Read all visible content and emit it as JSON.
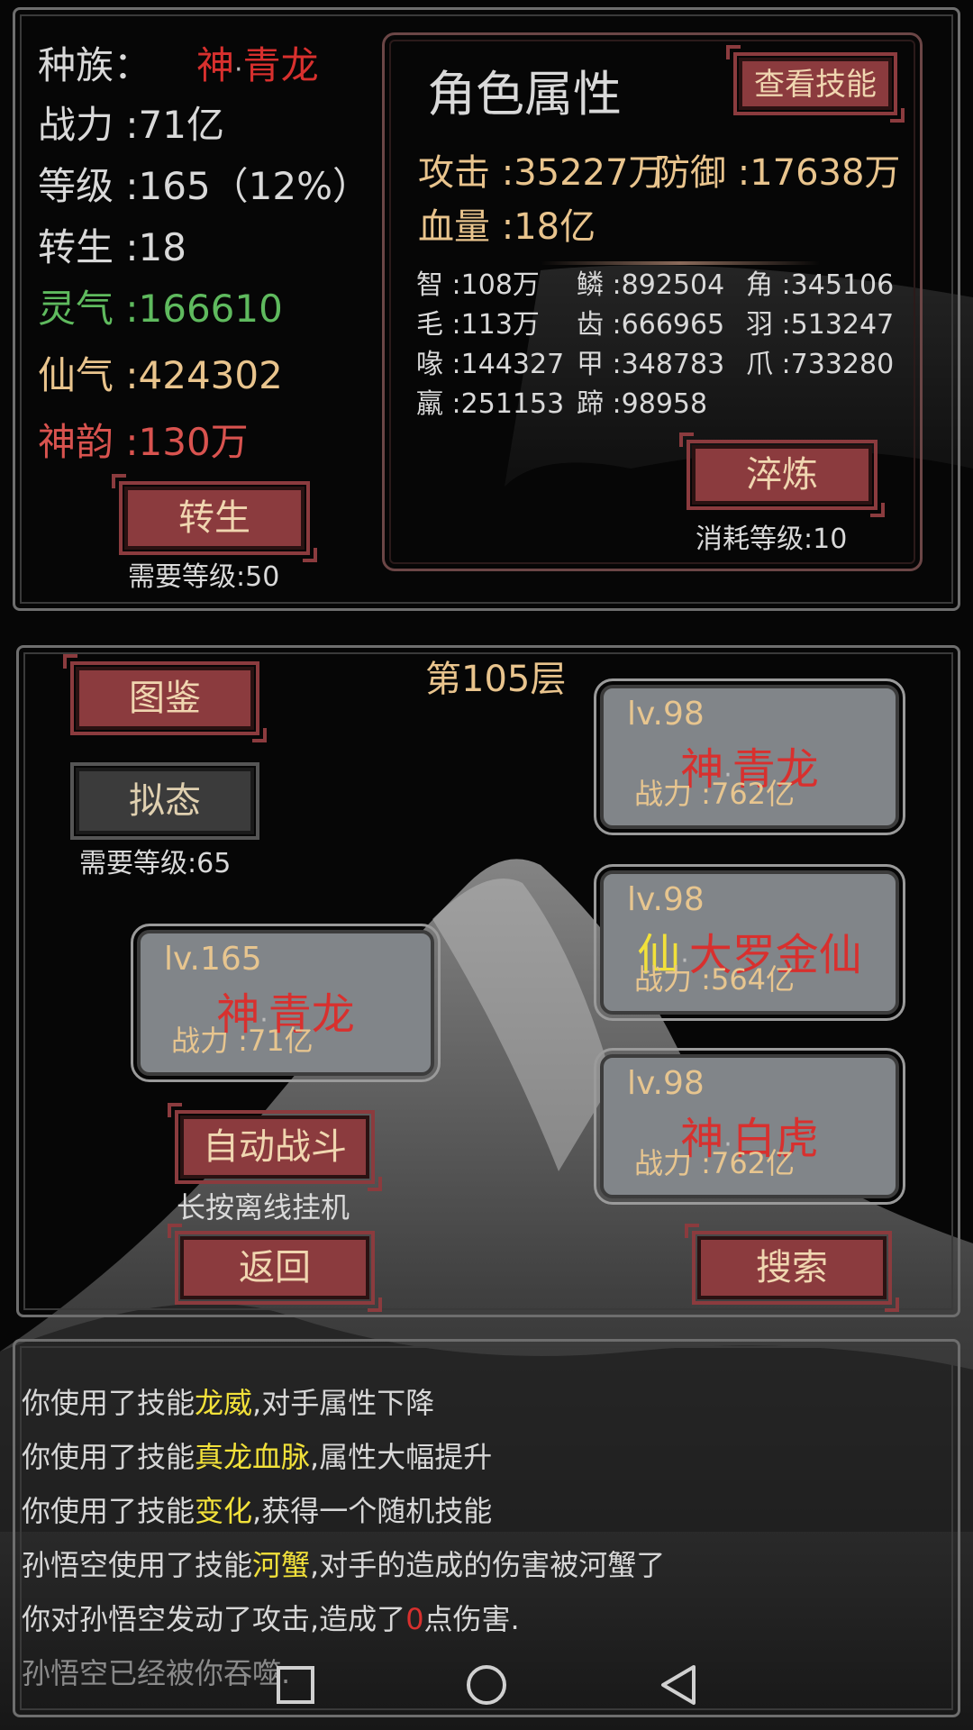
{
  "stats": {
    "race_label": "种族：",
    "race_prefix": "神",
    "race_sep": "·",
    "race_name": "青龙",
    "power": "战力 :71亿",
    "level": "等级 :165（12%）",
    "rebirth": "转生 :18",
    "lingqi": "灵气 :166610",
    "xianqi": "仙气 :424302",
    "shenyun": "神韵 :130万",
    "rebirth_button": "转生",
    "rebirth_req": "需要等级:50"
  },
  "attributes": {
    "title": "角色属性",
    "view_skills_button": "查看技能",
    "attack": "攻击 :35227万",
    "defense": "防御 :17638万",
    "hp": "血量 :18亿",
    "grid": [
      [
        "智 :108万",
        "鳞 :892504",
        "角 :345106"
      ],
      [
        "毛 :113万",
        "齿 :666965",
        "羽 :513247"
      ],
      [
        "喙 :144327",
        "甲 :348783",
        "爪 :733280"
      ],
      [
        "羸 :251153",
        "蹄 :98958",
        ""
      ]
    ],
    "refine_button": "淬炼",
    "refine_cost": "消耗等级:10"
  },
  "battle": {
    "floor": "第105层",
    "atlas_button": "图鉴",
    "mimic_button": "拟态",
    "mimic_req": "需要等级:65",
    "player": {
      "lv": "lv.165",
      "prefix": "神",
      "sep": "·",
      "name": "青龙",
      "power": "战力 :71亿"
    },
    "enemies": [
      {
        "lv": "lv.98",
        "prefix": "神",
        "sep": "·",
        "name": "青龙",
        "power": "战力 :762亿"
      },
      {
        "lv": "lv.98",
        "prefix": "仙",
        "sep": "·",
        "name": "大罗金仙",
        "power": "战力 :564亿"
      },
      {
        "lv": "lv.98",
        "prefix": "神",
        "sep": "·",
        "name": "白虎",
        "power": "战力 :762亿"
      }
    ],
    "auto_battle_button": "自动战斗",
    "auto_hint": "长按离线挂机",
    "back_button": "返回",
    "search_button": "搜索"
  },
  "log": {
    "l1a": "你使用了技能",
    "l1b": "龙威",
    "l1c": ",对手属性下降",
    "l2a": "你使用了技能",
    "l2b": "真龙血脉",
    "l2c": ",属性大幅提升",
    "l3a": "你使用了技能",
    "l3b": "变化",
    "l3c": ",获得一个随机技能",
    "l4a": "孙悟空使用了技能",
    "l4b": "河蟹",
    "l4c": ",对手的造成的伤害被河蟹了",
    "l5a": "你对孙悟空发动了攻击,造成了",
    "l5b": "0",
    "l5c": "点伤害.",
    "l6": "孙悟空已经被你吞噬."
  },
  "nav": {
    "items": [
      "recent-apps-icon",
      "home-icon",
      "back-icon"
    ]
  }
}
